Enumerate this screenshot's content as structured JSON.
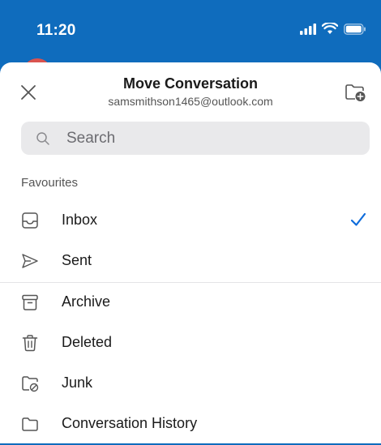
{
  "status": {
    "time": "11:20"
  },
  "header": {
    "title": "Move Conversation",
    "account": "samsmithson1465@outlook.com"
  },
  "search": {
    "placeholder": "Search"
  },
  "favourites": {
    "label": "Favourites",
    "items": [
      {
        "label": "Inbox",
        "icon": "inbox-icon",
        "selected": true
      },
      {
        "label": "Sent",
        "icon": "send-icon",
        "selected": false
      }
    ]
  },
  "folders": [
    {
      "label": "Archive",
      "icon": "archive-icon"
    },
    {
      "label": "Deleted",
      "icon": "trash-icon"
    },
    {
      "label": "Junk",
      "icon": "junk-folder-icon"
    },
    {
      "label": "Conversation History",
      "icon": "folder-icon"
    }
  ],
  "colors": {
    "accent": "#0f6cbd",
    "check": "#0f6cdb"
  }
}
